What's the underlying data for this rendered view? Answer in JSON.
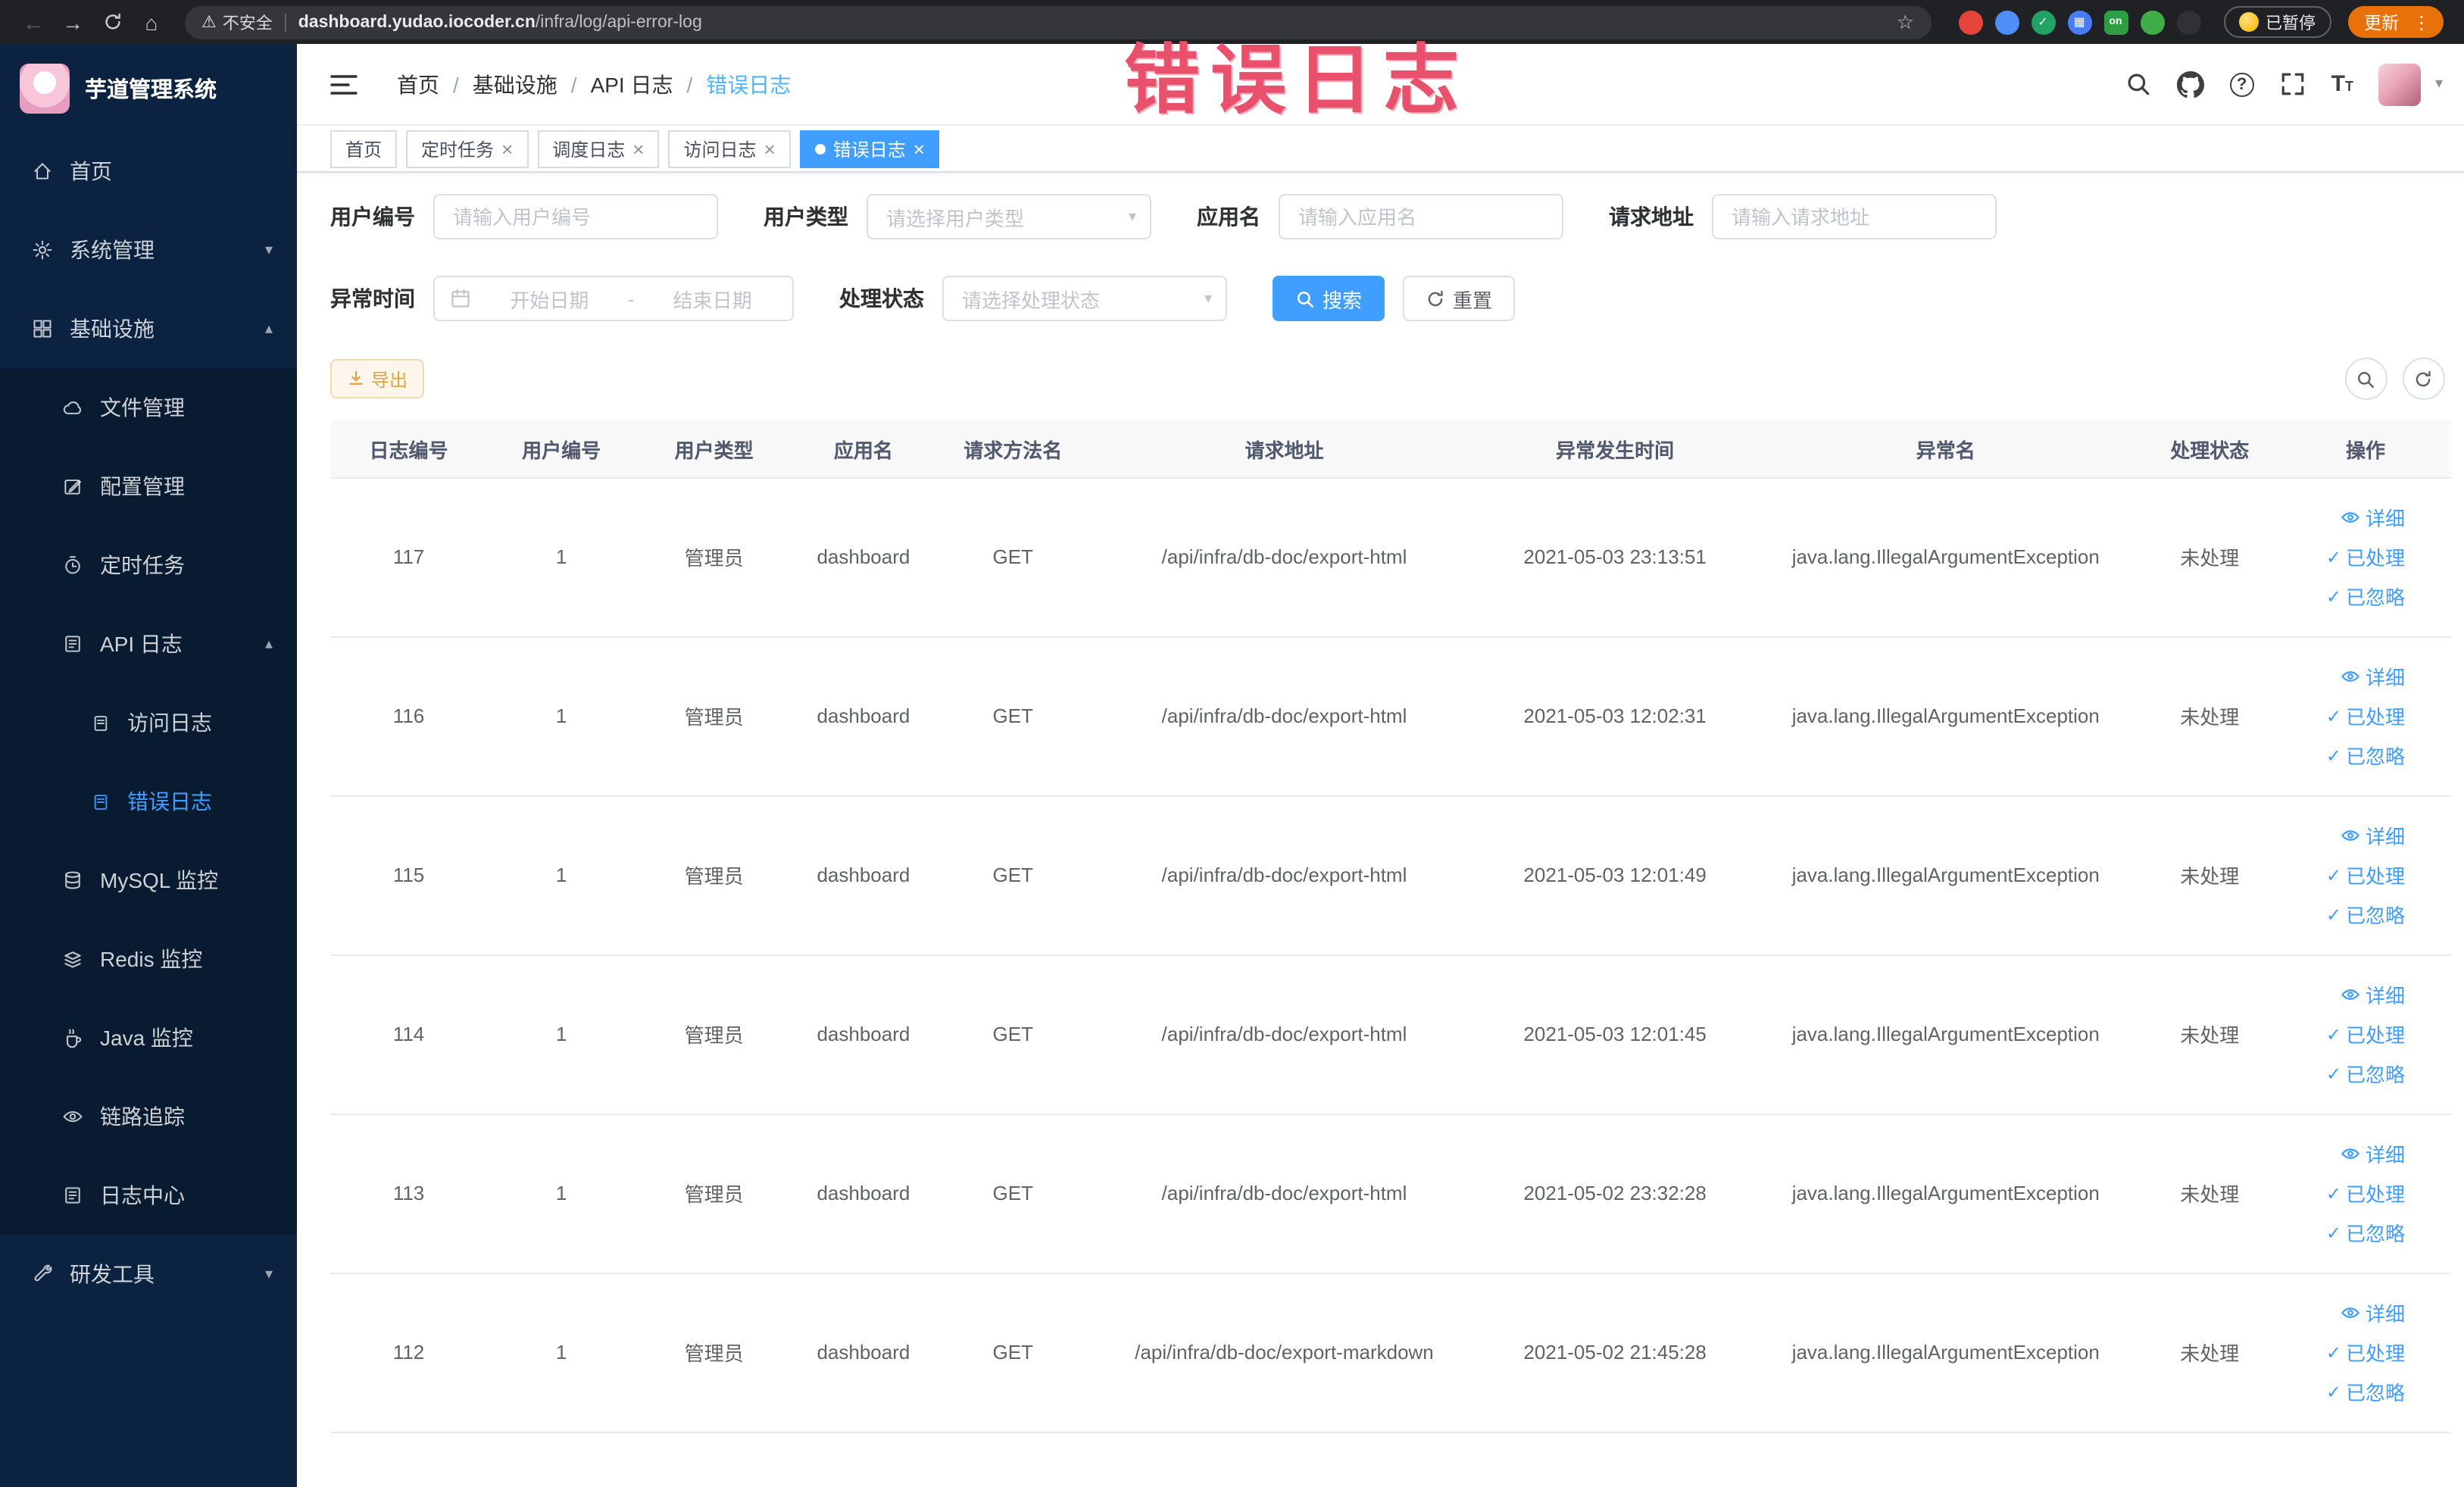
{
  "annotation": {
    "watermark": "错误日志",
    "color": "#e8506b"
  },
  "browser": {
    "security_label": "不安全",
    "url_domain": "dashboard.yudao.iocoder.cn",
    "url_path": "/infra/log/api-error-log",
    "paused_label": "已暂停",
    "update_label": "更新",
    "extensions": [
      {
        "name": "extension-red-circle-icon",
        "color": "#e5443b",
        "glyph": ""
      },
      {
        "name": "extension-blue-drop-icon",
        "color": "#4f8ef7",
        "glyph": ""
      },
      {
        "name": "extension-green-check-icon",
        "color": "#21a366",
        "glyph": "✓"
      },
      {
        "name": "extension-blue-grid-icon",
        "color": "#4a7bf7",
        "glyph": "▦"
      },
      {
        "name": "extension-on-badge-icon",
        "color": "#2e9e44",
        "glyph": "on"
      },
      {
        "name": "extension-green-leaf-icon",
        "color": "#3fae49",
        "glyph": ""
      },
      {
        "name": "extension-paw-icon",
        "color": "#2f3136",
        "glyph": ""
      }
    ]
  },
  "sidebar": {
    "logo_title": "芋道管理系统",
    "items": [
      {
        "id": "home",
        "label": "首页",
        "icon": "home-icon",
        "level": 1
      },
      {
        "id": "system-mgmt",
        "label": "系统管理",
        "icon": "gear-icon",
        "level": 1,
        "expand": "down"
      },
      {
        "id": "infra",
        "label": "基础设施",
        "icon": "grid-icon",
        "level": 1,
        "expand": "up"
      },
      {
        "id": "file-mgmt",
        "label": "文件管理",
        "icon": "cloud-icon",
        "level": 2
      },
      {
        "id": "config-mgmt",
        "label": "配置管理",
        "icon": "edit-icon",
        "level": 2
      },
      {
        "id": "cron-task",
        "label": "定时任务",
        "icon": "timer-icon",
        "level": 2
      },
      {
        "id": "api-log",
        "label": "API 日志",
        "icon": "api-icon",
        "level": 2,
        "expand": "up"
      },
      {
        "id": "access-log",
        "label": "访问日志",
        "icon": "doc-icon",
        "level": 3
      },
      {
        "id": "error-log",
        "label": "错误日志",
        "icon": "doc-icon",
        "level": 3,
        "active": true
      },
      {
        "id": "mysql-monitor",
        "label": "MySQL 监控",
        "icon": "mysql-icon",
        "level": 2
      },
      {
        "id": "redis-monitor",
        "label": "Redis 监控",
        "icon": "redis-icon",
        "level": 2
      },
      {
        "id": "java-monitor",
        "label": "Java 监控",
        "icon": "java-icon",
        "level": 2
      },
      {
        "id": "tracing",
        "label": "链路追踪",
        "icon": "eye-icon",
        "level": 2
      },
      {
        "id": "log-center",
        "label": "日志中心",
        "icon": "log-icon",
        "level": 2
      },
      {
        "id": "dev-tools",
        "label": "研发工具",
        "icon": "tools-icon",
        "level": 1,
        "expand": "down"
      }
    ]
  },
  "header": {
    "breadcrumb": [
      "首页",
      "基础设施",
      "API 日志",
      "错误日志"
    ]
  },
  "tabs": [
    {
      "id": "home",
      "label": "首页",
      "closable": false
    },
    {
      "id": "cron-task",
      "label": "定时任务",
      "closable": true
    },
    {
      "id": "cron-log",
      "label": "调度日志",
      "closable": true
    },
    {
      "id": "access-log",
      "label": "访问日志",
      "closable": true
    },
    {
      "id": "error-log",
      "label": "错误日志",
      "closable": true,
      "active": true
    }
  ],
  "filters": {
    "user_id": {
      "label": "用户编号",
      "placeholder": "请输入用户编号"
    },
    "user_type": {
      "label": "用户类型",
      "placeholder": "请选择用户类型"
    },
    "app_name": {
      "label": "应用名",
      "placeholder": "请输入应用名"
    },
    "request_url": {
      "label": "请求地址",
      "placeholder": "请输入请求地址"
    },
    "exception_time": {
      "label": "异常时间",
      "start_placeholder": "开始日期",
      "separator": "-",
      "end_placeholder": "结束日期"
    },
    "process_status": {
      "label": "处理状态",
      "placeholder": "请选择处理状态"
    },
    "search_label": "搜索",
    "reset_label": "重置"
  },
  "toolbar": {
    "export_label": "导出"
  },
  "table": {
    "columns": [
      "日志编号",
      "用户编号",
      "用户类型",
      "应用名",
      "请求方法名",
      "请求地址",
      "异常发生时间",
      "异常名",
      "处理状态",
      "操作"
    ],
    "actions": [
      {
        "id": "detail",
        "label": "详细"
      },
      {
        "id": "processed",
        "label": "已处理"
      },
      {
        "id": "ignore",
        "label": "已忽略"
      }
    ],
    "rows": [
      {
        "id": "117",
        "user_id": "1",
        "user_type": "管理员",
        "app": "dashboard",
        "method": "GET",
        "url": "/api/infra/db-doc/export-html",
        "time": "2021-05-03 23:13:51",
        "exception": "java.lang.IllegalArgumentException",
        "status": "未处理"
      },
      {
        "id": "116",
        "user_id": "1",
        "user_type": "管理员",
        "app": "dashboard",
        "method": "GET",
        "url": "/api/infra/db-doc/export-html",
        "time": "2021-05-03 12:02:31",
        "exception": "java.lang.IllegalArgumentException",
        "status": "未处理"
      },
      {
        "id": "115",
        "user_id": "1",
        "user_type": "管理员",
        "app": "dashboard",
        "method": "GET",
        "url": "/api/infra/db-doc/export-html",
        "time": "2021-05-03 12:01:49",
        "exception": "java.lang.IllegalArgumentException",
        "status": "未处理"
      },
      {
        "id": "114",
        "user_id": "1",
        "user_type": "管理员",
        "app": "dashboard",
        "method": "GET",
        "url": "/api/infra/db-doc/export-html",
        "time": "2021-05-03 12:01:45",
        "exception": "java.lang.IllegalArgumentException",
        "status": "未处理"
      },
      {
        "id": "113",
        "user_id": "1",
        "user_type": "管理员",
        "app": "dashboard",
        "method": "GET",
        "url": "/api/infra/db-doc/export-html",
        "time": "2021-05-02 23:32:28",
        "exception": "java.lang.IllegalArgumentException",
        "status": "未处理"
      },
      {
        "id": "112",
        "user_id": "1",
        "user_type": "管理员",
        "app": "dashboard",
        "method": "GET",
        "url": "/api/infra/db-doc/export-markdown",
        "time": "2021-05-02 21:45:28",
        "exception": "java.lang.IllegalArgumentException",
        "status": "未处理"
      }
    ]
  }
}
